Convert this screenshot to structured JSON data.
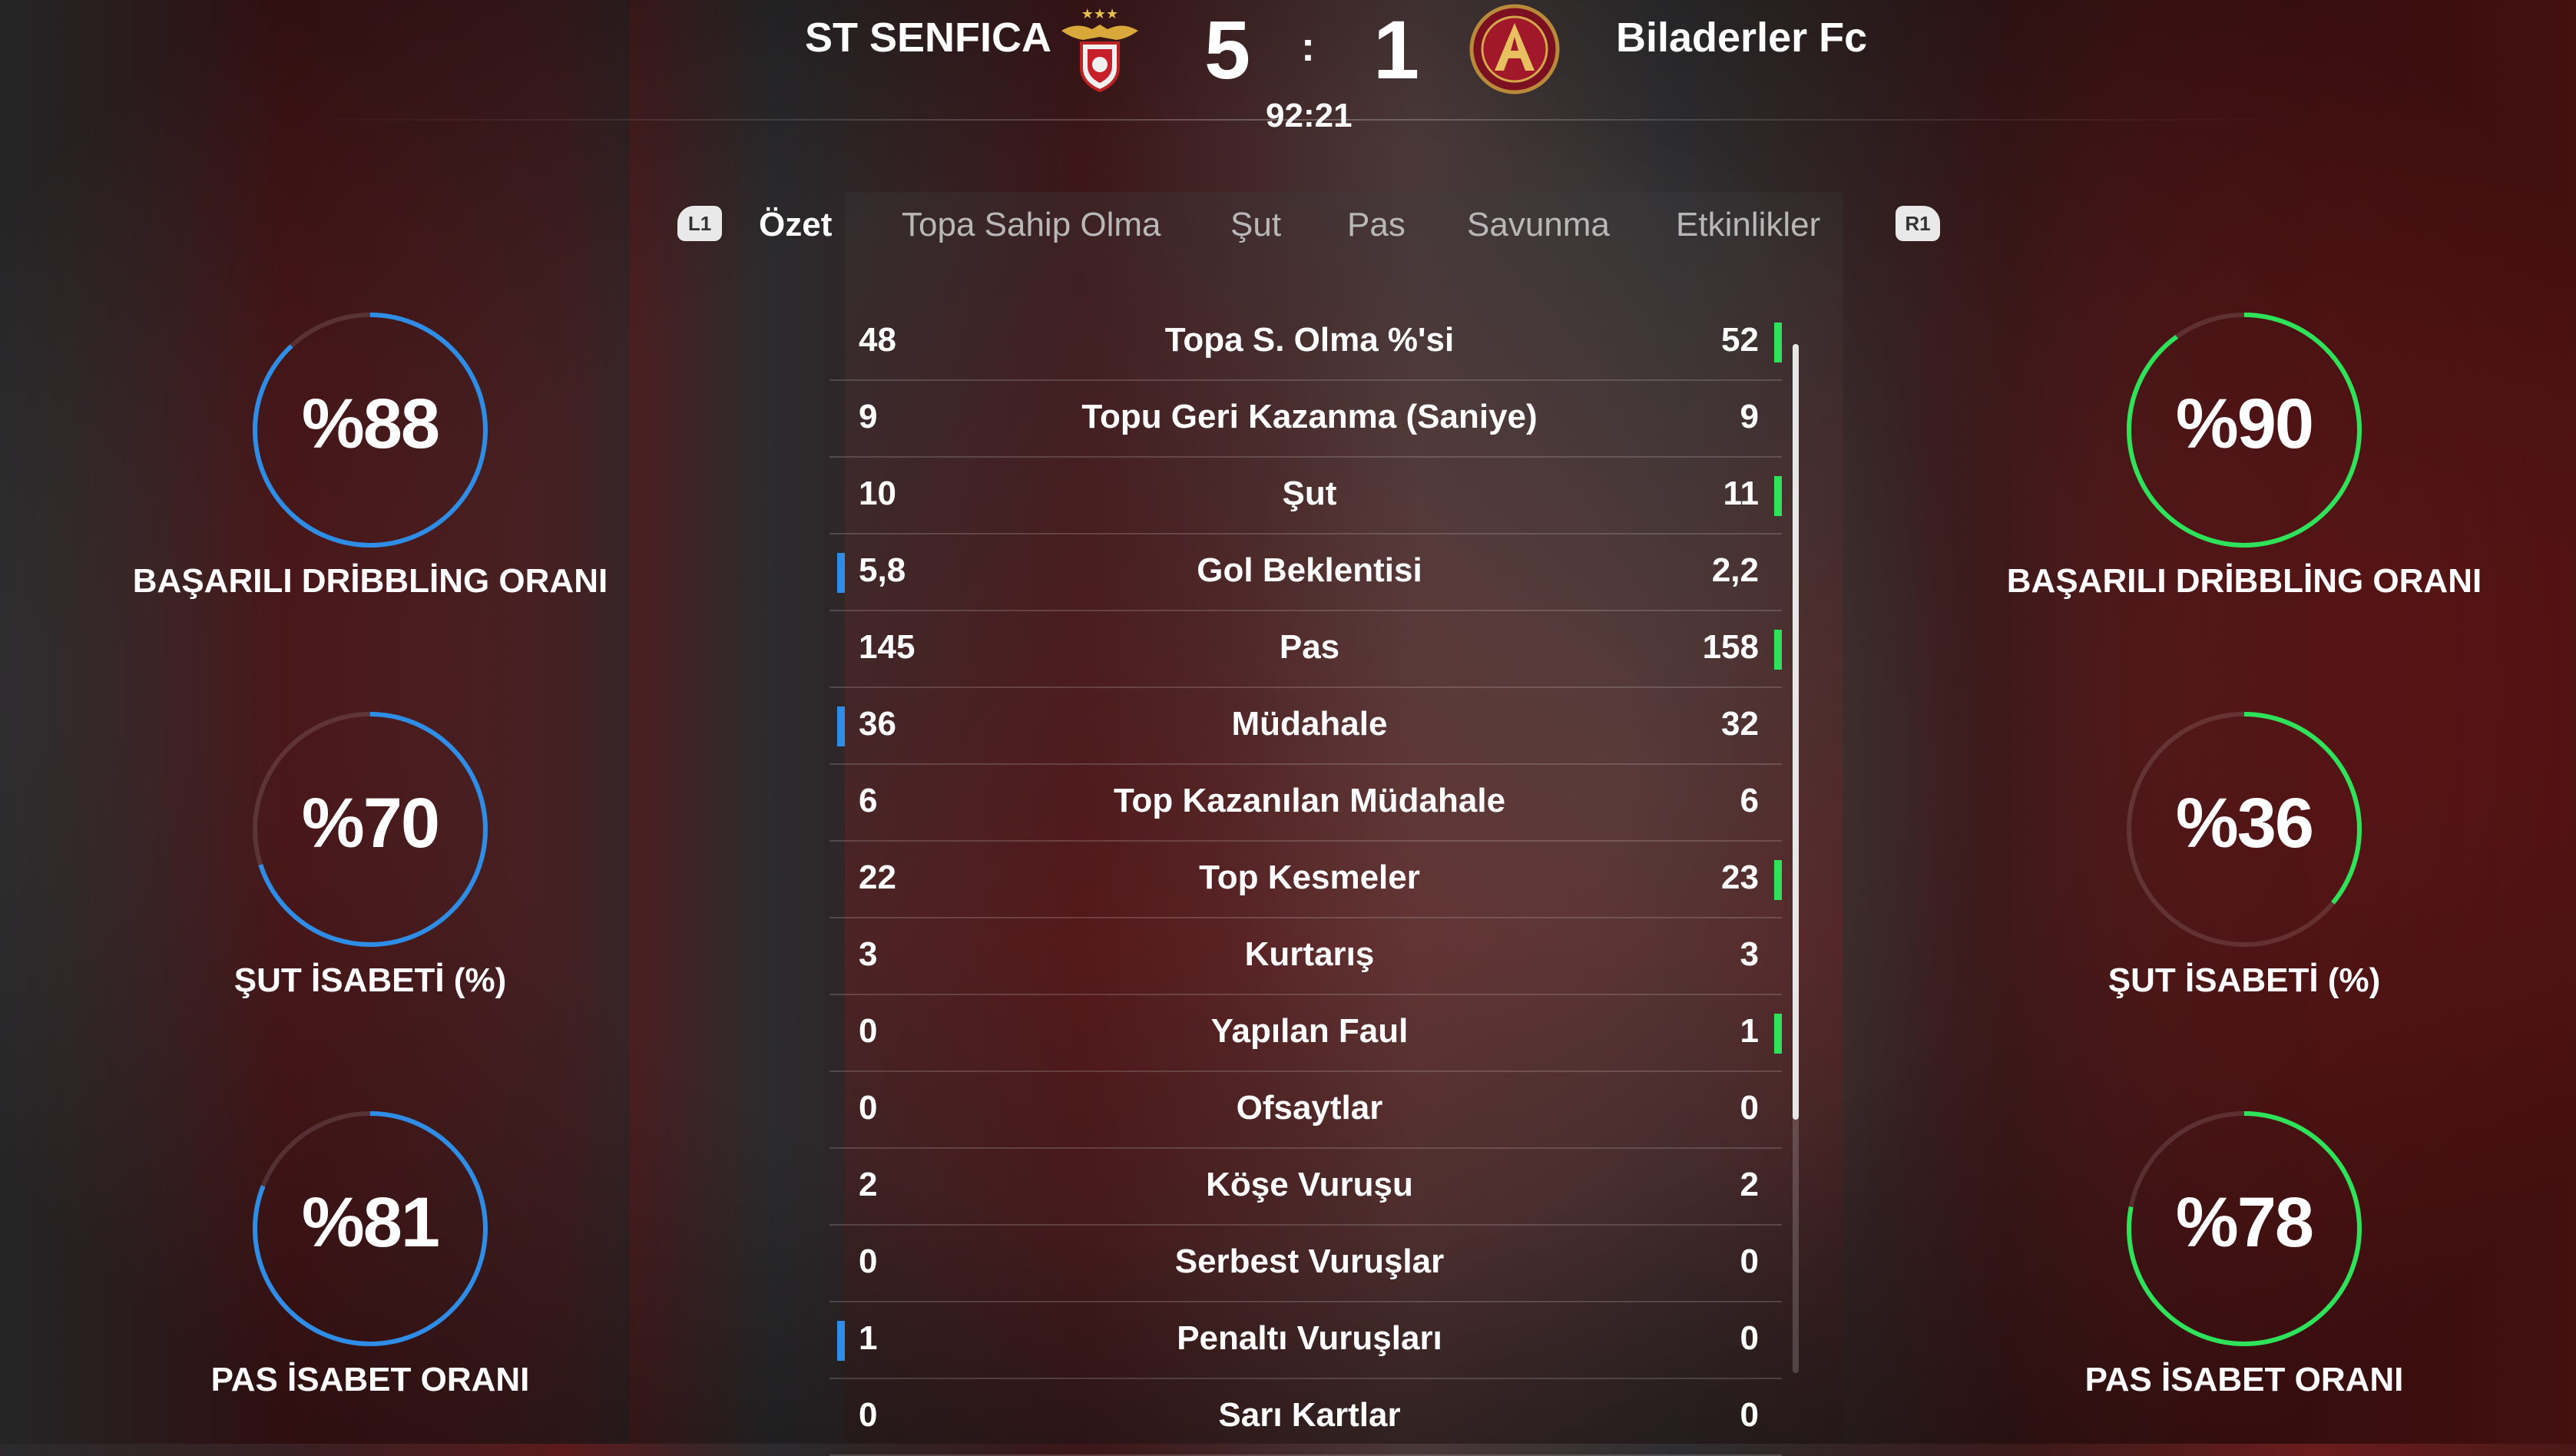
{
  "header": {
    "home_team": "ST SENFICA",
    "away_team": "Biladerler Fc",
    "home_score": "5",
    "away_score": "1",
    "separator": ":",
    "clock": "92:21",
    "home_crest": "eagle-crest-icon",
    "away_crest": "atlanta-united-crest-icon"
  },
  "tabs": {
    "prev_button": "L1",
    "next_button": "R1",
    "items": [
      "Özet",
      "Topa Sahip Olma",
      "Şut",
      "Pas",
      "Savunma",
      "Etkinlikler"
    ],
    "active": "Özet"
  },
  "colors": {
    "home_accent": "#2e8de6",
    "away_accent": "#2ee35a"
  },
  "stats": [
    {
      "label": "Topa S. Olma %'si",
      "home": "48",
      "away": "52",
      "leader": "away"
    },
    {
      "label": "Topu Geri Kazanma (Saniye)",
      "home": "9",
      "away": "9",
      "leader": "none"
    },
    {
      "label": "Şut",
      "home": "10",
      "away": "11",
      "leader": "away"
    },
    {
      "label": "Gol Beklentisi",
      "home": "5,8",
      "away": "2,2",
      "leader": "home"
    },
    {
      "label": "Pas",
      "home": "145",
      "away": "158",
      "leader": "away"
    },
    {
      "label": "Müdahale",
      "home": "36",
      "away": "32",
      "leader": "home"
    },
    {
      "label": "Top Kazanılan Müdahale",
      "home": "6",
      "away": "6",
      "leader": "none"
    },
    {
      "label": "Top Kesmeler",
      "home": "22",
      "away": "23",
      "leader": "away"
    },
    {
      "label": "Kurtarış",
      "home": "3",
      "away": "3",
      "leader": "none"
    },
    {
      "label": "Yapılan Faul",
      "home": "0",
      "away": "1",
      "leader": "away"
    },
    {
      "label": "Ofsaytlar",
      "home": "0",
      "away": "0",
      "leader": "none"
    },
    {
      "label": "Köşe Vuruşu",
      "home": "2",
      "away": "2",
      "leader": "none"
    },
    {
      "label": "Serbest Vuruşlar",
      "home": "0",
      "away": "0",
      "leader": "none"
    },
    {
      "label": "Penaltı Vuruşları",
      "home": "1",
      "away": "0",
      "leader": "home"
    },
    {
      "label": "Sarı Kartlar",
      "home": "0",
      "away": "0",
      "leader": "none"
    }
  ],
  "gauges": {
    "home": [
      {
        "pct_text": "%88",
        "value": 88,
        "label": "BAŞARILI DRİBBLİNG ORANI"
      },
      {
        "pct_text": "%70",
        "value": 70,
        "label": "ŞUT İSABETİ (%)"
      },
      {
        "pct_text": "%81",
        "value": 81,
        "label": "PAS İSABET ORANI"
      }
    ],
    "away": [
      {
        "pct_text": "%90",
        "value": 90,
        "label": "BAŞARILI DRİBBLİNG ORANI"
      },
      {
        "pct_text": "%36",
        "value": 36,
        "label": "ŞUT İSABETİ (%)"
      },
      {
        "pct_text": "%78",
        "value": 78,
        "label": "PAS İSABET ORANI"
      }
    ]
  }
}
